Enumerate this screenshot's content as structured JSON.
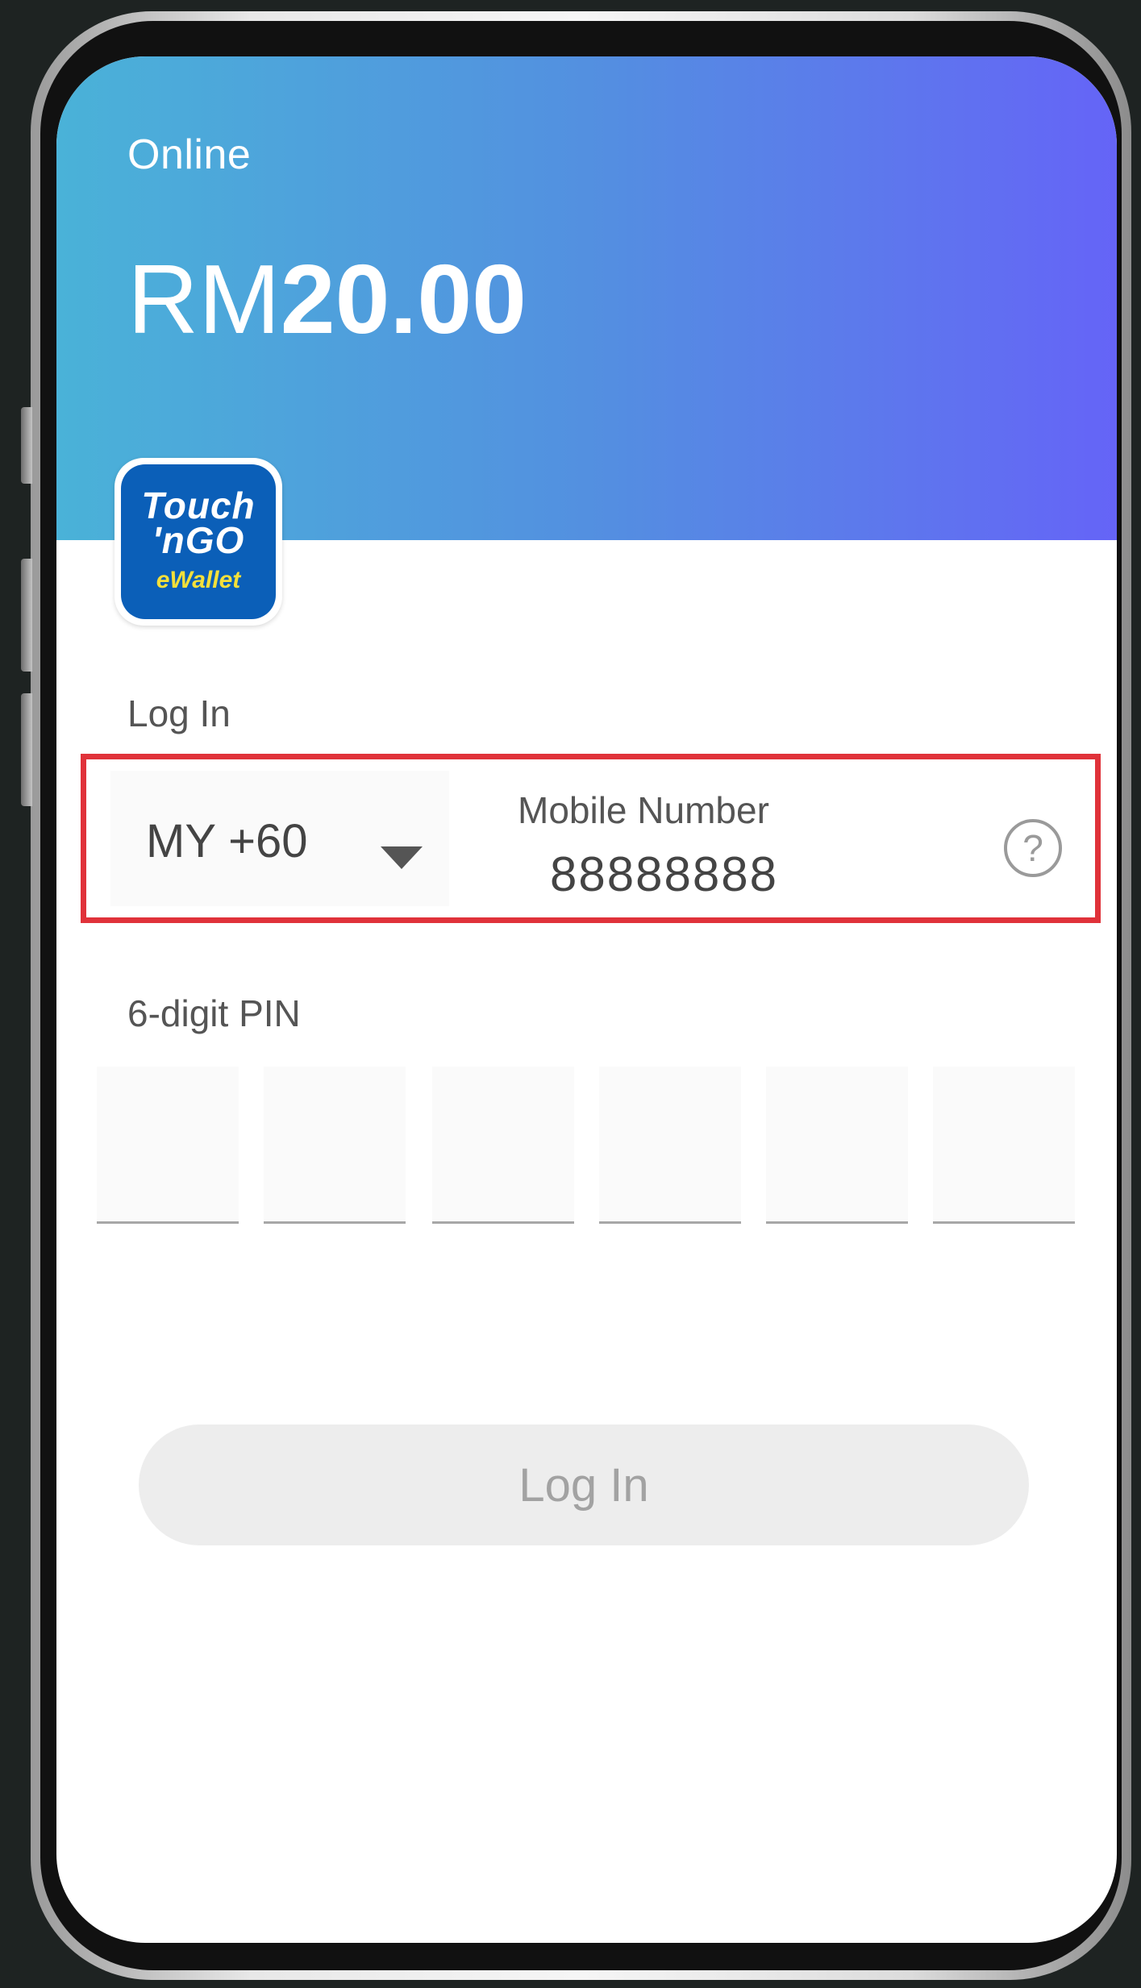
{
  "header": {
    "status": "Online",
    "balance_currency": "RM",
    "balance_amount": "20.00"
  },
  "logo": {
    "line1": "Touch",
    "line2": "'nGO",
    "line3": "eWallet",
    "brand_color": "#0b5fb8",
    "accent_color": "#f5e03a"
  },
  "login": {
    "section_label": "Log In",
    "country_code": "MY +60",
    "mobile_label": "Mobile Number",
    "mobile_value": "88888888",
    "help_icon": "question-circle-icon",
    "pin_label": "6-digit PIN",
    "pin_digits": [
      "",
      "",
      "",
      "",
      "",
      ""
    ],
    "button_label": "Log In"
  },
  "colors": {
    "gradient_start": "#4ab2d8",
    "gradient_end": "#6564f7",
    "highlight_border": "#e0323a"
  }
}
